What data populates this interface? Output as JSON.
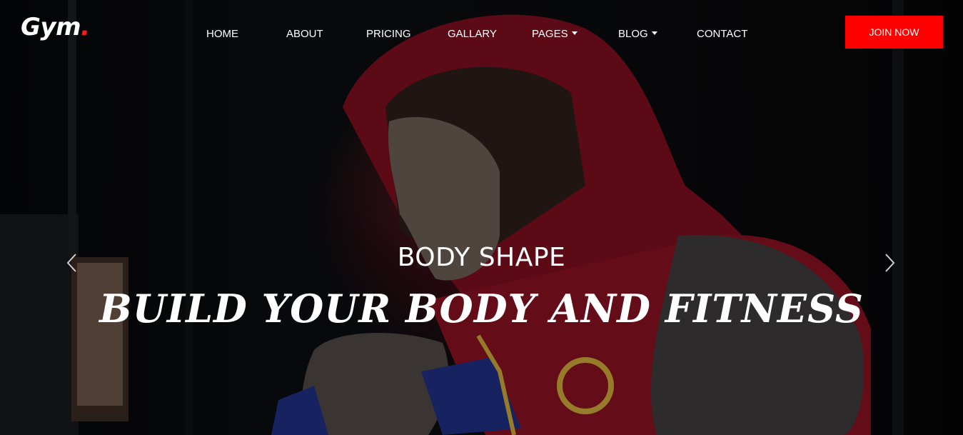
{
  "header": {
    "logo_text": "Gym",
    "logo_dot": "."
  },
  "nav": {
    "items": [
      {
        "label": "HOME"
      },
      {
        "label": "ABOUT"
      },
      {
        "label": "PRICING"
      },
      {
        "label": "GALLARY"
      },
      {
        "label": "PAGES",
        "has_dropdown": true
      },
      {
        "label": "BLOG",
        "has_dropdown": true
      },
      {
        "label": "CONTACT"
      }
    ],
    "cta_label": "JOIN NOW"
  },
  "hero": {
    "subtitle": "BODY SHAPE",
    "title": "BUILD YOUR BODY AND FITNESS"
  },
  "slider": {
    "prev_icon": "chevron-left-icon",
    "next_icon": "chevron-right-icon"
  },
  "colors": {
    "accent": "#ff0000",
    "text": "#ffffff",
    "background": "#000000"
  }
}
